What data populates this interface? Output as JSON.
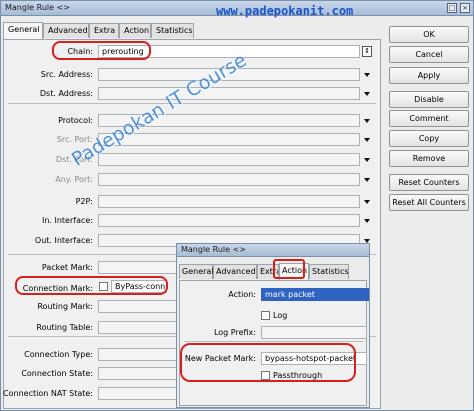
{
  "main": {
    "title": "Mangle Rule <>",
    "title_buttons": [
      "□",
      "×"
    ],
    "tabs": [
      "General",
      "Advanced",
      "Extra",
      "Action",
      "Statistics"
    ],
    "fields": [
      {
        "label": "Chain:",
        "value": "prerouting",
        "dim": false
      },
      {
        "label": "Src. Address:",
        "value": "",
        "dim": false
      },
      {
        "label": "Dst. Address:",
        "value": "",
        "dim": false
      },
      {
        "label": "Protocol:",
        "value": "",
        "dim": false
      },
      {
        "label": "Src. Port:",
        "value": "",
        "dim": true
      },
      {
        "label": "Dst. Port:",
        "value": "",
        "dim": true
      },
      {
        "label": "Any. Port:",
        "value": "",
        "dim": true
      },
      {
        "label": "P2P:",
        "value": "",
        "dim": false
      },
      {
        "label": "In. Interface:",
        "value": "",
        "dim": false
      },
      {
        "label": "Out. Interface:",
        "value": "",
        "dim": false
      },
      {
        "label": "Packet Mark:",
        "value": "",
        "dim": false
      },
      {
        "label": "Connection Mark:",
        "value": "ByPass-conn",
        "dim": false
      },
      {
        "label": "Routing Mark:",
        "value": "",
        "dim": false
      },
      {
        "label": "Routing Table:",
        "value": "",
        "dim": false
      },
      {
        "label": "Connection Type:",
        "value": "",
        "dim": false
      },
      {
        "label": "Connection State:",
        "value": "",
        "dim": false
      },
      {
        "label": "Connection NAT State:",
        "value": "",
        "dim": false
      }
    ],
    "buttons": [
      "OK",
      "Cancel",
      "Apply",
      "Disable",
      "Comment",
      "Copy",
      "Remove",
      "Reset Counters",
      "Reset All Counters"
    ]
  },
  "overlay": {
    "title": "Mangle Rule <>",
    "tabs": [
      "General",
      "Advanced",
      "Extra",
      "Action",
      "Statistics"
    ],
    "action_label": "Action:",
    "action_value": "mark packet",
    "log_label": "Log",
    "log_prefix_label": "Log Prefix:",
    "new_packet_mark_label": "New Packet Mark:",
    "new_packet_mark_value": "bypass-hotspot-packet",
    "passthrough_label": "Passthrough"
  },
  "watermark": "Padepokan IT Course",
  "site": "www.padepokanit.com",
  "colors": {
    "highlight": "#d6201c",
    "watermark": "#2f7fd4",
    "site": "#1b56c8",
    "selection": "#2f63c2"
  }
}
